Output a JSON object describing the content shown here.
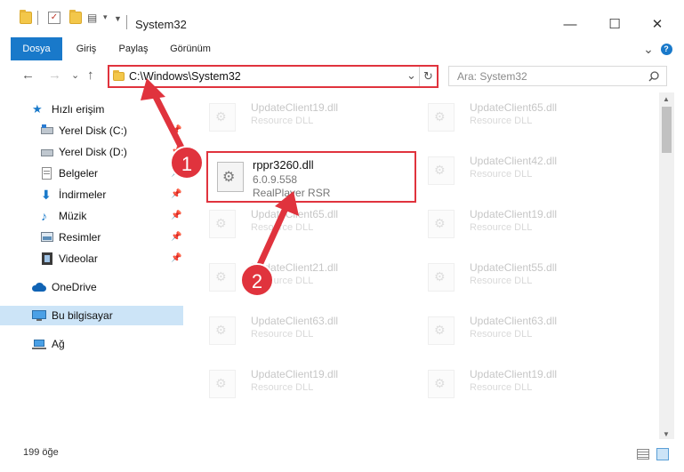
{
  "window": {
    "title": "System32",
    "minimize_glyph": "—",
    "maximize_glyph": "☐",
    "close_glyph": "✕"
  },
  "ribbon": {
    "tabs": [
      "Dosya",
      "Giriş",
      "Paylaş",
      "Görünüm"
    ],
    "expand_glyph": "⌄",
    "help_glyph": "?"
  },
  "address": {
    "path": "C:\\Windows\\System32",
    "back_glyph": "←",
    "forward_glyph": "→",
    "recent_glyph": "⌄",
    "up_glyph": "↑",
    "dropdown_glyph": "⌄",
    "refresh_glyph": "↻",
    "search_placeholder": "Ara: System32",
    "search_icon": "search-icon"
  },
  "sidebar": {
    "items": [
      {
        "label": "Hızlı erişim",
        "icon": "star-icon"
      },
      {
        "label": "Yerel Disk (C:)",
        "icon": "drive-icon"
      },
      {
        "label": "Yerel Disk (D:)",
        "icon": "drive-icon"
      },
      {
        "label": "Belgeler",
        "icon": "documents-icon"
      },
      {
        "label": "İndirmeler",
        "icon": "download-icon"
      },
      {
        "label": "Müzik",
        "icon": "music-icon"
      },
      {
        "label": "Resimler",
        "icon": "pictures-icon"
      },
      {
        "label": "Videolar",
        "icon": "video-icon"
      },
      {
        "label": "OneDrive",
        "icon": "cloud-icon"
      },
      {
        "label": "Bu bilgisayar",
        "icon": "computer-icon"
      },
      {
        "label": "Ağ",
        "icon": "network-icon"
      }
    ],
    "pin_glyph": "📌"
  },
  "files": {
    "left_column": [
      {
        "name": "UpdateClient19.dll",
        "desc": "Resource DLL"
      },
      {
        "name": "UpdateClient65.dll",
        "desc": "Resource DLL"
      },
      {
        "name": "UpdateClient21.dll",
        "desc": "Resource DLL"
      },
      {
        "name": "UpdateClient63.dll",
        "desc": "Resource DLL"
      },
      {
        "name": "UpdateClient19.dll",
        "desc": "Resource DLL"
      }
    ],
    "right_column": [
      {
        "name": "UpdateClient65.dll",
        "desc": "Resource DLL"
      },
      {
        "name": "UpdateClient42.dll",
        "desc": "Resource DLL"
      },
      {
        "name": "UpdateClient19.dll",
        "desc": "Resource DLL"
      },
      {
        "name": "UpdateClient55.dll",
        "desc": "Resource DLL"
      },
      {
        "name": "UpdateClient63.dll",
        "desc": "Resource DLL"
      },
      {
        "name": "UpdateClient19.dll",
        "desc": "Resource DLL"
      }
    ],
    "highlighted": {
      "name": "rppr3260.dll",
      "version": "6.0.9.558",
      "desc": "RealPlayer RSR"
    }
  },
  "status": {
    "count": "199 öğe"
  },
  "annotations": {
    "step1": "1",
    "step2": "2",
    "color": "#e0333d"
  },
  "colors": {
    "accent": "#1979ca",
    "selection": "#cce4f7",
    "highlight": "#e0333d"
  }
}
